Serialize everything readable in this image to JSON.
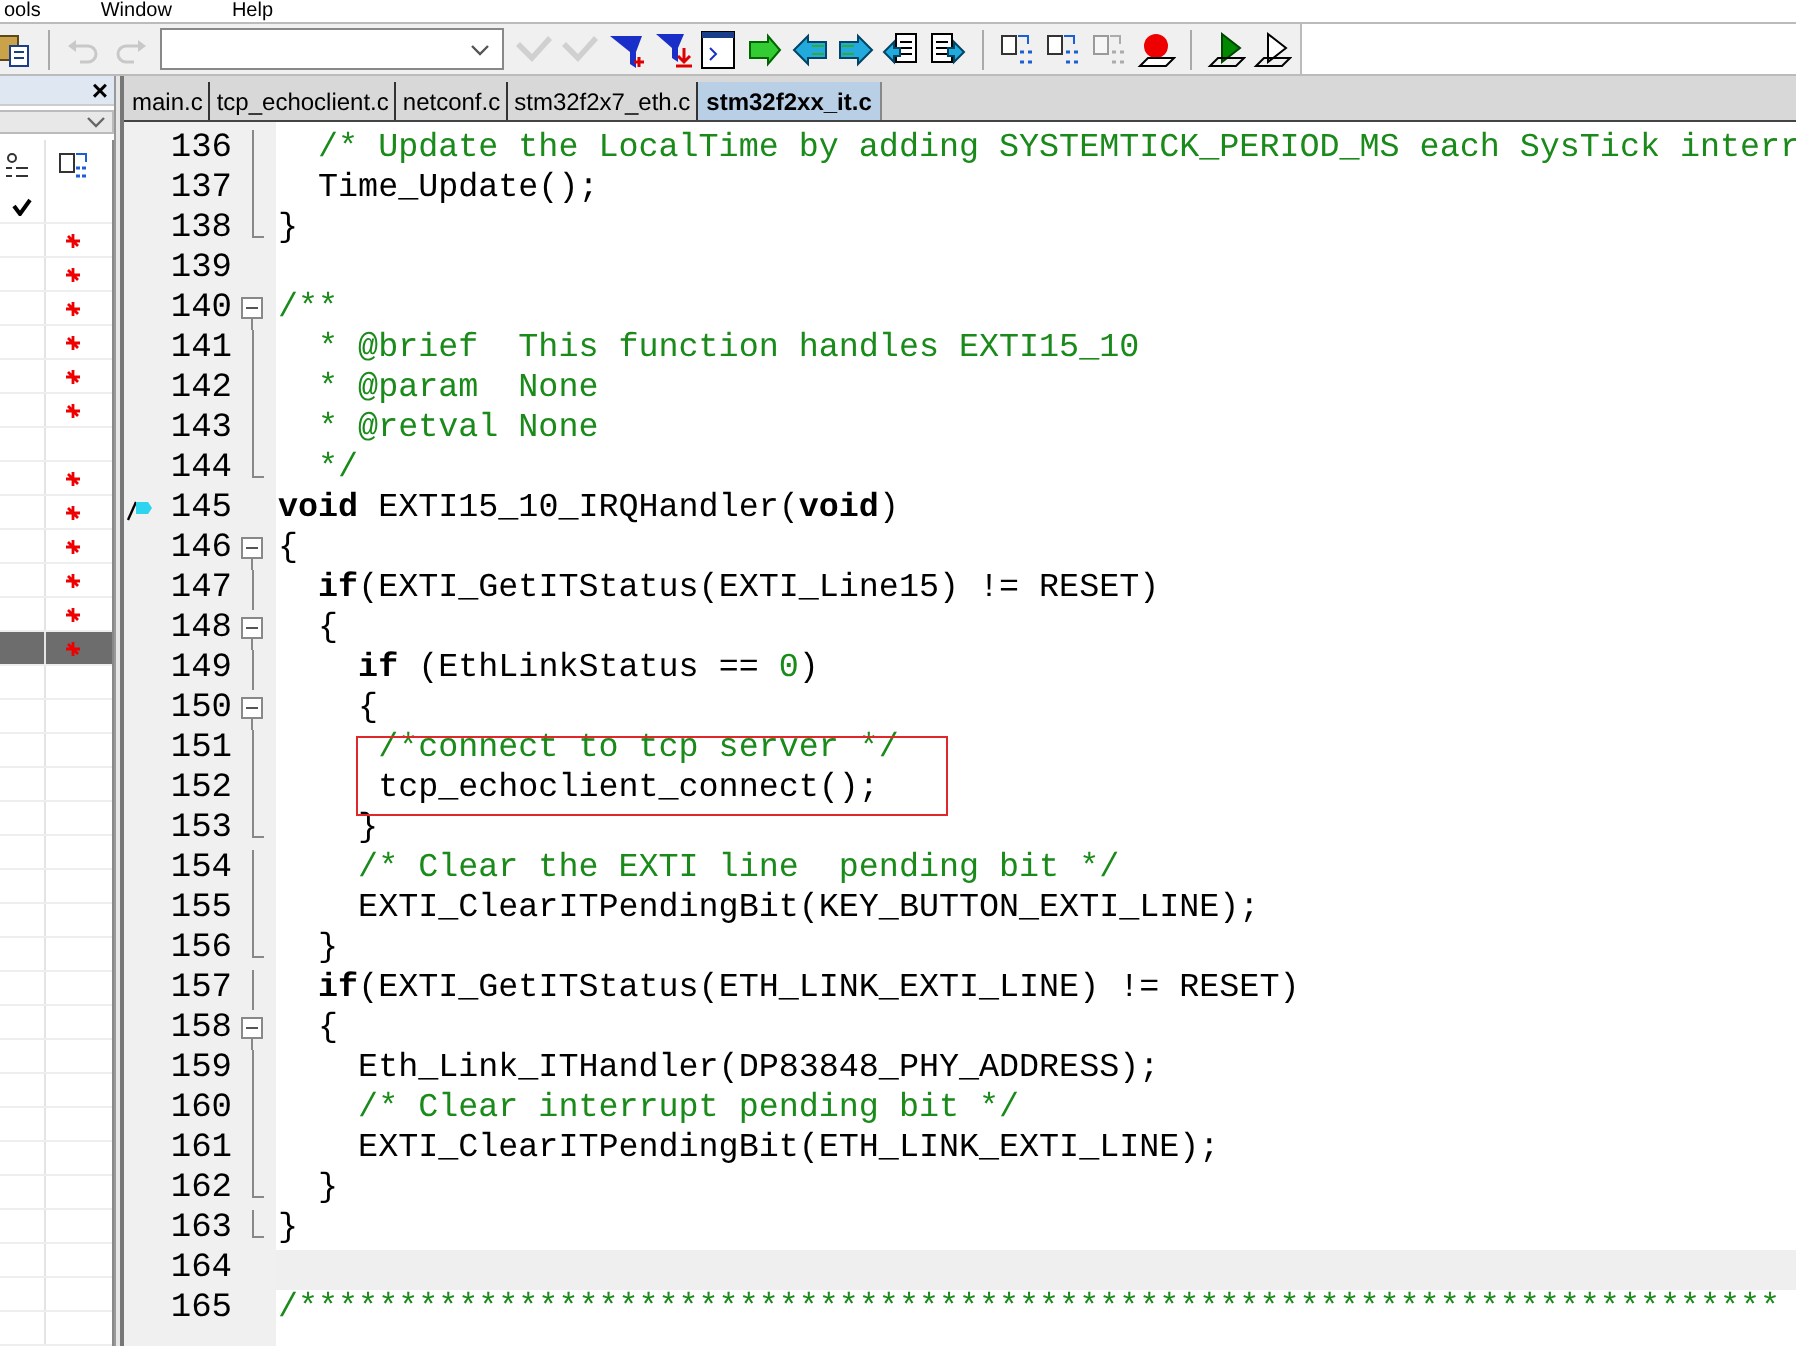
{
  "menu": [
    "ools",
    "Window",
    "Help"
  ],
  "toolbar": [
    {
      "kind": "paste",
      "disabled": false
    },
    {
      "kind": "sep"
    },
    {
      "kind": "undo",
      "disabled": true
    },
    {
      "kind": "redo",
      "disabled": true
    },
    {
      "kind": "combo"
    },
    {
      "kind": "check",
      "disabled": true
    },
    {
      "kind": "check",
      "disabled": true
    },
    {
      "kind": "funnel-plus",
      "disabled": false
    },
    {
      "kind": "funnel-arrow",
      "disabled": false
    },
    {
      "kind": "window",
      "disabled": false
    },
    {
      "kind": "arrow-right",
      "disabled": false
    },
    {
      "kind": "arrow-left",
      "disabled": false
    },
    {
      "kind": "arrow-right-cyan",
      "disabled": false
    },
    {
      "kind": "doc-left",
      "disabled": false
    },
    {
      "kind": "doc-right",
      "disabled": false
    },
    {
      "kind": "sep"
    },
    {
      "kind": "binary",
      "disabled": false
    },
    {
      "kind": "binary",
      "disabled": false
    },
    {
      "kind": "binary",
      "disabled": true
    },
    {
      "kind": "record",
      "disabled": false
    },
    {
      "kind": "sep"
    },
    {
      "kind": "play",
      "disabled": false
    },
    {
      "kind": "play-outline",
      "disabled": false
    }
  ],
  "left_panel": {
    "close": "×",
    "rows": [
      {
        "checked": true,
        "marked": false,
        "selected": false
      },
      {
        "checked": false,
        "marked": true,
        "selected": false
      },
      {
        "checked": false,
        "marked": true,
        "selected": false
      },
      {
        "checked": false,
        "marked": true,
        "selected": false
      },
      {
        "checked": false,
        "marked": true,
        "selected": false
      },
      {
        "checked": false,
        "marked": true,
        "selected": false
      },
      {
        "checked": false,
        "marked": true,
        "selected": false
      },
      {
        "checked": false,
        "marked": false,
        "selected": false
      },
      {
        "checked": false,
        "marked": true,
        "selected": false
      },
      {
        "checked": false,
        "marked": true,
        "selected": false
      },
      {
        "checked": false,
        "marked": true,
        "selected": false
      },
      {
        "checked": false,
        "marked": true,
        "selected": false
      },
      {
        "checked": false,
        "marked": true,
        "selected": false
      },
      {
        "checked": false,
        "marked": true,
        "selected": true
      },
      {
        "checked": false,
        "marked": false,
        "selected": false
      },
      {
        "checked": false,
        "marked": false,
        "selected": false
      },
      {
        "checked": false,
        "marked": false,
        "selected": false
      },
      {
        "checked": false,
        "marked": false,
        "selected": false
      },
      {
        "checked": false,
        "marked": false,
        "selected": false
      },
      {
        "checked": false,
        "marked": false,
        "selected": false
      },
      {
        "checked": false,
        "marked": false,
        "selected": false
      },
      {
        "checked": false,
        "marked": false,
        "selected": false
      },
      {
        "checked": false,
        "marked": false,
        "selected": false
      },
      {
        "checked": false,
        "marked": false,
        "selected": false
      },
      {
        "checked": false,
        "marked": false,
        "selected": false
      },
      {
        "checked": false,
        "marked": false,
        "selected": false
      },
      {
        "checked": false,
        "marked": false,
        "selected": false
      },
      {
        "checked": false,
        "marked": false,
        "selected": false
      },
      {
        "checked": false,
        "marked": false,
        "selected": false
      },
      {
        "checked": false,
        "marked": false,
        "selected": false
      },
      {
        "checked": false,
        "marked": false,
        "selected": false
      },
      {
        "checked": false,
        "marked": false,
        "selected": false
      },
      {
        "checked": false,
        "marked": false,
        "selected": false
      },
      {
        "checked": false,
        "marked": false,
        "selected": false
      }
    ]
  },
  "tabs": [
    {
      "label": "main.c",
      "selected": false
    },
    {
      "label": "tcp_echoclient.c",
      "selected": false
    },
    {
      "label": "netconf.c",
      "selected": false
    },
    {
      "label": "stm32f2x7_eth.c",
      "selected": false
    },
    {
      "label": "stm32f2xx_it.c",
      "selected": true
    }
  ],
  "editor": {
    "lines": [
      {
        "number": "136",
        "kind": "fold-body",
        "segs": [
          {
            "kind": "comment",
            "text": "  /* Update the LocalTime by adding SYSTEMTICK_PERIOD_MS each SysTick interr"
          }
        ]
      },
      {
        "number": "137",
        "kind": "fold-body",
        "segs": [
          {
            "kind": "plain",
            "text": "  Time_Update();"
          }
        ]
      },
      {
        "number": "138",
        "kind": "fold-end",
        "segs": [
          {
            "kind": "plain",
            "text": "}"
          }
        ]
      },
      {
        "number": "139",
        "kind": "plain"
      },
      {
        "number": "140",
        "kind": "fold-start",
        "segs": [
          {
            "kind": "comment",
            "text": "/**"
          }
        ]
      },
      {
        "number": "141",
        "kind": "fold-body",
        "segs": [
          {
            "kind": "comment",
            "text": "  * @brief  This function handles EXTI15_10"
          }
        ]
      },
      {
        "number": "142",
        "kind": "fold-body",
        "segs": [
          {
            "kind": "comment",
            "text": "  * @param  None"
          }
        ]
      },
      {
        "number": "143",
        "kind": "fold-body",
        "segs": [
          {
            "kind": "comment",
            "text": "  * @retval None"
          }
        ]
      },
      {
        "number": "144",
        "kind": "fold-end",
        "segs": [
          {
            "kind": "comment",
            "text": "  */"
          }
        ]
      },
      {
        "number": "145",
        "kind": "plain",
        "bookmark": true,
        "segs": [
          {
            "kind": "keyword",
            "text": "void"
          },
          {
            "kind": "plain",
            "text": " EXTI15_10_IRQHandler("
          },
          {
            "kind": "keyword",
            "text": "void"
          },
          {
            "kind": "plain",
            "text": ")"
          }
        ]
      },
      {
        "number": "146",
        "kind": "fold-start",
        "segs": [
          {
            "kind": "plain",
            "text": "{"
          }
        ]
      },
      {
        "number": "147",
        "kind": "fold-body",
        "segs": [
          {
            "kind": "keyword",
            "text": "  if"
          },
          {
            "kind": "plain",
            "text": "(EXTI_GetITStatus(EXTI_Line15) != RESET)"
          }
        ]
      },
      {
        "number": "148",
        "kind": "fold-start",
        "segs": [
          {
            "kind": "plain",
            "text": "  {"
          }
        ]
      },
      {
        "number": "149",
        "kind": "fold-body",
        "segs": [
          {
            "kind": "keyword",
            "text": "    if"
          },
          {
            "kind": "plain",
            "text": " (EthLinkStatus == "
          },
          {
            "kind": "number",
            "text": "0"
          },
          {
            "kind": "plain",
            "text": ")"
          }
        ]
      },
      {
        "number": "150",
        "kind": "fold-start",
        "segs": [
          {
            "kind": "plain",
            "text": "    {"
          }
        ]
      },
      {
        "number": "151",
        "kind": "fold-body",
        "boxed": true,
        "segs": [
          {
            "kind": "comment",
            "text": "     /*connect to tcp server */"
          }
        ]
      },
      {
        "number": "152",
        "kind": "fold-body",
        "boxed": true,
        "segs": [
          {
            "kind": "plain",
            "text": "     tcp_echoclient_connect();"
          }
        ]
      },
      {
        "number": "153",
        "kind": "fold-end",
        "segs": [
          {
            "kind": "plain",
            "text": "    }"
          }
        ]
      },
      {
        "number": "154",
        "kind": "fold-body",
        "segs": [
          {
            "kind": "comment",
            "text": "    /* Clear the EXTI line  pending bit */"
          }
        ]
      },
      {
        "number": "155",
        "kind": "fold-body",
        "segs": [
          {
            "kind": "plain",
            "text": "    EXTI_ClearITPendingBit(KEY_BUTTON_EXTI_LINE);"
          }
        ]
      },
      {
        "number": "156",
        "kind": "fold-end",
        "segs": [
          {
            "kind": "plain",
            "text": "  }"
          }
        ]
      },
      {
        "number": "157",
        "kind": "fold-body",
        "segs": [
          {
            "kind": "keyword",
            "text": "  if"
          },
          {
            "kind": "plain",
            "text": "(EXTI_GetITStatus(ETH_LINK_EXTI_LINE) != RESET)"
          }
        ]
      },
      {
        "number": "158",
        "kind": "fold-start",
        "segs": [
          {
            "kind": "plain",
            "text": "  {"
          }
        ]
      },
      {
        "number": "159",
        "kind": "fold-body",
        "segs": [
          {
            "kind": "plain",
            "text": "    Eth_Link_ITHandler(DP83848_PHY_ADDRESS);"
          }
        ]
      },
      {
        "number": "160",
        "kind": "fold-body",
        "segs": [
          {
            "kind": "comment",
            "text": "    /* Clear interrupt pending bit */"
          }
        ]
      },
      {
        "number": "161",
        "kind": "fold-body",
        "segs": [
          {
            "kind": "plain",
            "text": "    EXTI_ClearITPendingBit(ETH_LINK_EXTI_LINE);"
          }
        ]
      },
      {
        "number": "162",
        "kind": "fold-end",
        "segs": [
          {
            "kind": "plain",
            "text": "  }"
          }
        ]
      },
      {
        "number": "163",
        "kind": "fold-end",
        "segs": [
          {
            "kind": "plain",
            "text": "}"
          }
        ]
      },
      {
        "number": "164",
        "kind": "plain",
        "current": true
      },
      {
        "number": "165",
        "kind": "plain",
        "segs": [
          {
            "kind": "comment",
            "text": "/**************************************************************************"
          }
        ]
      }
    ]
  }
}
